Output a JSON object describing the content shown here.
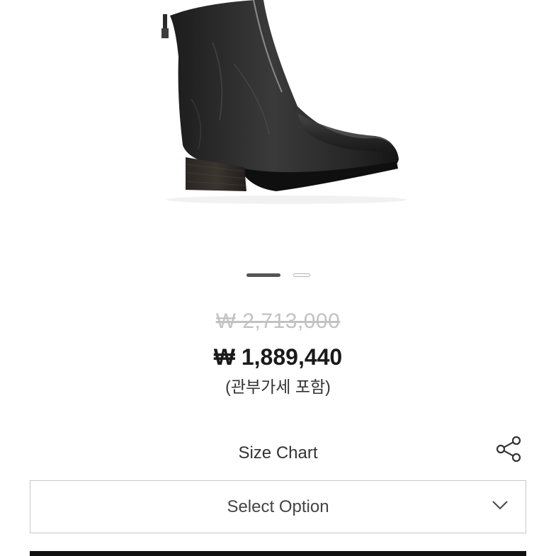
{
  "product": {
    "image_alt": "Black leather front-zip ankle boot",
    "carousel": {
      "total": 2,
      "active_index": 1
    }
  },
  "price": {
    "original": "₩ 2,713,000",
    "sale": "₩ 1,889,440",
    "tax_note": "(관부가세 포함)"
  },
  "actions": {
    "size_chart_label": "Size Chart",
    "share_icon": "share-icon"
  },
  "option_select": {
    "label": "Select Option",
    "icon": "chevron-down-icon"
  },
  "colors": {
    "text_primary": "#1a1a1a",
    "strikethrough": "#c2c2c2",
    "border": "#c8c8c8",
    "bar": "#111111"
  }
}
